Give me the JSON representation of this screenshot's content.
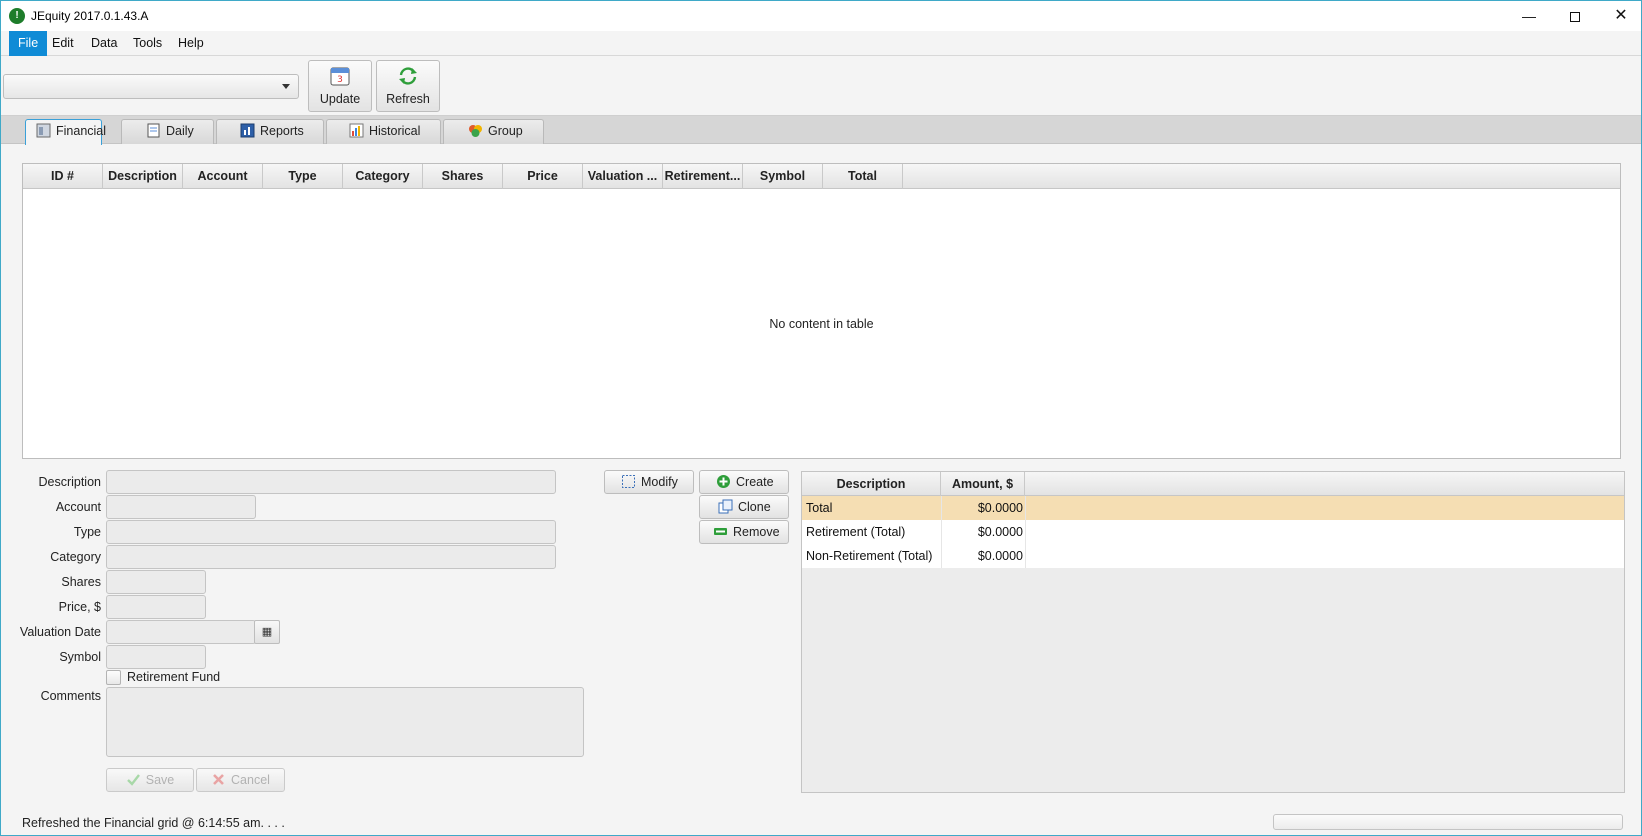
{
  "window": {
    "title": "JEquity 2017.0.1.43.A",
    "minimize": "—",
    "close": "✕"
  },
  "menu": [
    "File",
    "Edit",
    "Data",
    "Tools",
    "Help"
  ],
  "toolbar": {
    "combo_value": "",
    "update_label": "Update",
    "refresh_label": "Refresh",
    "calendar_number": "3"
  },
  "tabs": [
    "Financial",
    "Daily",
    "Reports",
    "Historical",
    "Group"
  ],
  "grid": {
    "columns": [
      "ID #",
      "Description",
      "Account",
      "Type",
      "Category",
      "Shares",
      "Price",
      "Valuation ...",
      "Retirement...",
      "Symbol",
      "Total"
    ],
    "empty_message": "No content in table"
  },
  "form": {
    "labels": {
      "description": "Description",
      "account": "Account",
      "type": "Type",
      "category": "Category",
      "shares": "Shares",
      "price": "Price, $",
      "valuation_date": "Valuation Date",
      "symbol": "Symbol",
      "comments": "Comments"
    },
    "retirement_fund_label": "Retirement Fund",
    "save_label": "Save",
    "cancel_label": "Cancel"
  },
  "actions": {
    "modify": "Modify",
    "create": "Create",
    "clone": "Clone",
    "remove": "Remove"
  },
  "summary": {
    "columns": [
      "Description",
      "Amount, $"
    ],
    "rows": [
      {
        "description": "Total",
        "amount": "$0.0000"
      },
      {
        "description": "Retirement (Total)",
        "amount": "$0.0000"
      },
      {
        "description": "Non-Retirement (Total)",
        "amount": "$0.0000"
      }
    ]
  },
  "status": {
    "message": "Refreshed the Financial grid @ 6:14:55 am. . . ."
  },
  "colors": {
    "accent": "#0f8bd6",
    "selected_row": "#f5deb3",
    "window_border": "#3fa9c8"
  }
}
